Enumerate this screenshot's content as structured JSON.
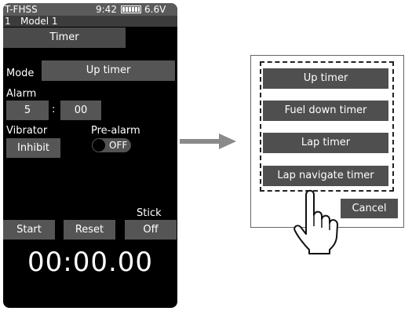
{
  "status": {
    "system": "T-FHSS",
    "time": "9:42",
    "voltage": "6.6V"
  },
  "model": {
    "number": "1",
    "name": "Model 1"
  },
  "screen": {
    "title": "Timer",
    "mode_label": "Mode",
    "mode_value": "Up timer",
    "alarm_label": "Alarm",
    "alarm_min": "5",
    "alarm_sep": ":",
    "alarm_sec": "00",
    "vibrator_label": "Vibrator",
    "vibrator_value": "Inhibit",
    "prealarm_label": "Pre-alarm",
    "prealarm_value": "OFF",
    "stick_label": "Stick",
    "start_label": "Start",
    "reset_label": "Reset",
    "stick_value": "Off",
    "timer_display": "00:00.00"
  },
  "popup": {
    "options": [
      "Up timer",
      "Fuel down timer",
      "Lap timer",
      "Lap navigate timer"
    ],
    "cancel_label": "Cancel"
  },
  "icons": {
    "battery": "battery-icon",
    "toggle": "toggle-switch",
    "arrow": "right-arrow-icon",
    "hand": "pointing-hand-icon"
  }
}
